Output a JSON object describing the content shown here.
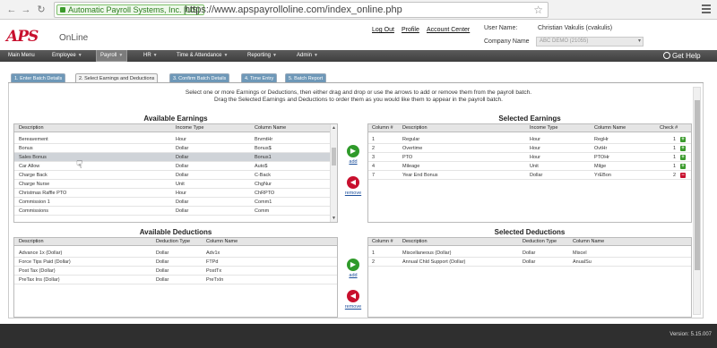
{
  "browser": {
    "secure_label": "Automatic Payroll Systems, Inc. [US]",
    "url": "https://www.apspayrolloline.com/index_online.php"
  },
  "header": {
    "logo": "APS",
    "product": "OnLine",
    "links": {
      "logout": "Log Out",
      "profile": "Profile",
      "account_center": "Account Center"
    },
    "user_name_label": "User Name:",
    "user_name_value": "Christian Vakulis (cvakulis)",
    "company_name_label": "Company Name",
    "company_name_value": "ABC DEMO (21055)"
  },
  "mainnav": {
    "items": [
      "Main Menu",
      "Employee",
      "Payroll",
      "HR",
      "Time & Attendance",
      "Reporting",
      "Admin"
    ],
    "help": "Get Help"
  },
  "tabs": [
    "1. Enter Batch Details",
    "2. Select Earnings and Deductions",
    "3. Confirm Batch Details",
    "4. Time Entry",
    "5. Batch Report"
  ],
  "instructions": {
    "line1": "Select one or more Earnings or Deductions, then either drag and drop or use the arrows to add or remove them from the payroll batch.",
    "line2": "Drag the Selected Earnings and Deductions to order them as you would like them to appear in the payroll batch."
  },
  "available_earnings": {
    "title": "Available Earnings",
    "headers": [
      "Description",
      "Income Type",
      "Column Name"
    ],
    "rows": [
      [
        "Bereavement",
        "Hour",
        "BrvmtHr"
      ],
      [
        "Bonus",
        "Dollar",
        "Bonus$"
      ],
      [
        "Sales Bonus",
        "Dollar",
        "Bonus1"
      ],
      [
        "Car Allow",
        "Dollar",
        "Auto$"
      ],
      [
        "Charge Back",
        "Dollar",
        "C-Back"
      ],
      [
        "Charge Nurse",
        "Unit",
        "ChgNur"
      ],
      [
        "Christmas Raffle PTO",
        "Hour",
        "ChRPTO"
      ],
      [
        "Commission 1",
        "Dollar",
        "Comm1"
      ],
      [
        "Commissions",
        "Dollar",
        "Comm"
      ]
    ]
  },
  "selected_earnings": {
    "title": "Selected Earnings",
    "headers": [
      "Column #",
      "Description",
      "Income Type",
      "Column Name",
      "Check #"
    ],
    "rows": [
      [
        "1",
        "Regular",
        "Hour",
        "RegHr",
        "1"
      ],
      [
        "2",
        "Overtime",
        "Hour",
        "OvtHr",
        "1"
      ],
      [
        "3",
        "PTO",
        "Hour",
        "PTOHr",
        "1"
      ],
      [
        "4",
        "Mileage",
        "Unit",
        "Milge",
        "1"
      ],
      [
        "7",
        "Year End Bonus",
        "Dollar",
        "YrEBon",
        "2"
      ]
    ]
  },
  "available_deductions": {
    "title": "Available Deductions",
    "headers": [
      "Description",
      "Deduction Type",
      "Column Name"
    ],
    "rows": [
      [
        "Advance 1x (Dollar)",
        "Dollar",
        "Adv1x"
      ],
      [
        "Force Tips Paid (Dollar)",
        "Dollar",
        "FTPd"
      ],
      [
        "Post Tax (Dollar)",
        "Dollar",
        "PostTx"
      ],
      [
        "PreTax Ins (Dollar)",
        "Dollar",
        "PreTxIn"
      ]
    ]
  },
  "selected_deductions": {
    "title": "Selected Deductions",
    "headers": [
      "Column #",
      "Description",
      "Deduction Type",
      "Column Name"
    ],
    "rows": [
      [
        "1",
        "Miscellaneous (Dollar)",
        "Dollar",
        "Miscel"
      ],
      [
        "2",
        "Annual Chld Support (Dollar)",
        "Dollar",
        "AnualSu"
      ]
    ]
  },
  "actions": {
    "add": "add",
    "remove": "remove"
  },
  "footer": {
    "version": "Version: 5.15.007"
  }
}
